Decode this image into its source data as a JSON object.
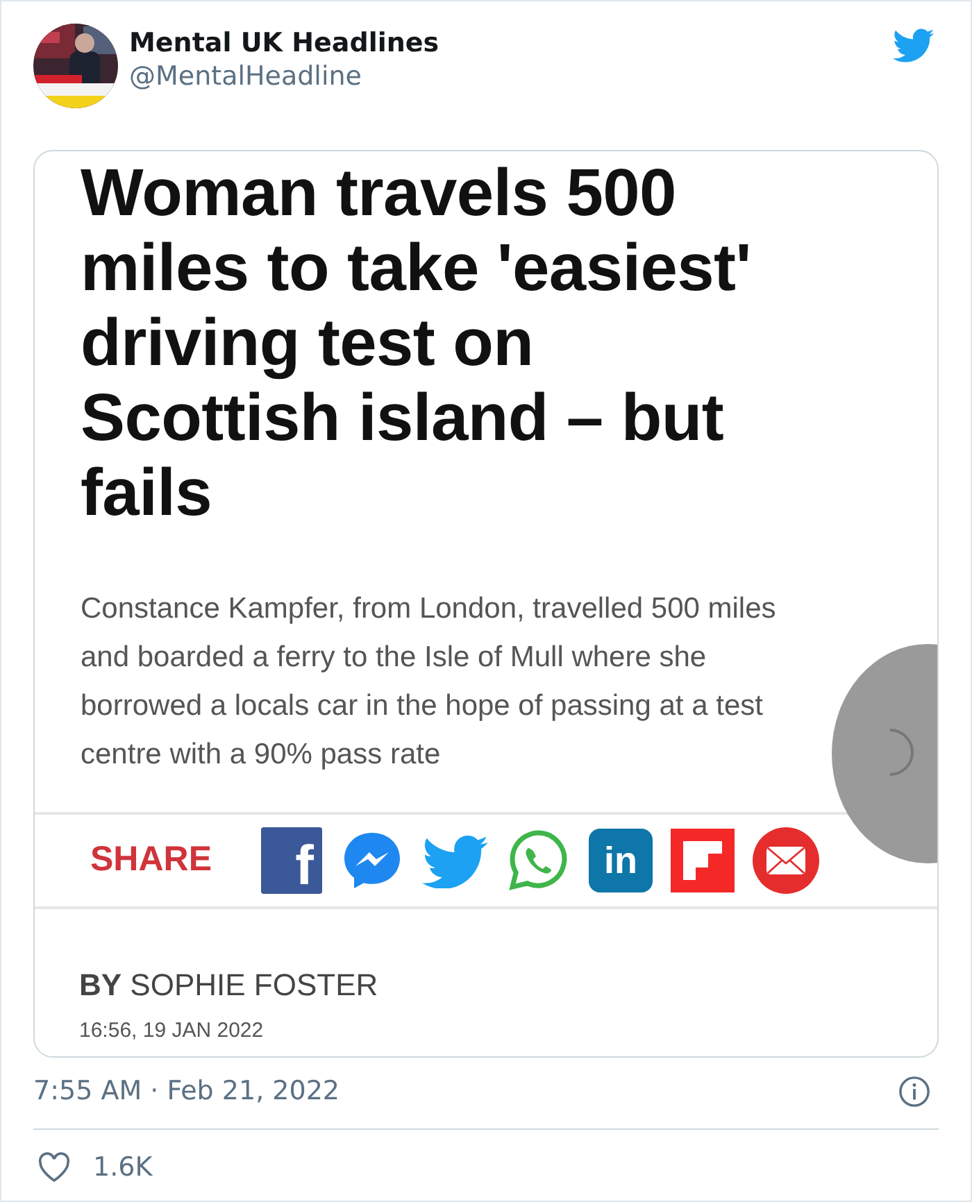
{
  "author": {
    "name": "Mental UK Headlines",
    "handle": "@MentalHeadline"
  },
  "article": {
    "headline": "Woman travels 500 miles to take 'easiest' driving test on Scottish island – but fails",
    "summary": "Constance Kampfer, from London, travelled 500 miles and boarded a ferry to the Isle of Mull where she borrowed a locals car in the hope of passing at a test centre with a 90% pass rate",
    "share_label": "SHARE",
    "share_icons": [
      {
        "kind": "facebook",
        "glyph": "f"
      },
      {
        "kind": "messenger"
      },
      {
        "kind": "twitter"
      },
      {
        "kind": "whatsapp"
      },
      {
        "kind": "linkedin",
        "glyph": "in"
      },
      {
        "kind": "flipboard"
      },
      {
        "kind": "email"
      }
    ],
    "byline_prefix": "BY",
    "author": "SOPHIE FOSTER",
    "published": "16:56, 19 JAN 2022"
  },
  "timestamp": "7:55 AM · Feb 21, 2022",
  "likes": "1.6K"
}
